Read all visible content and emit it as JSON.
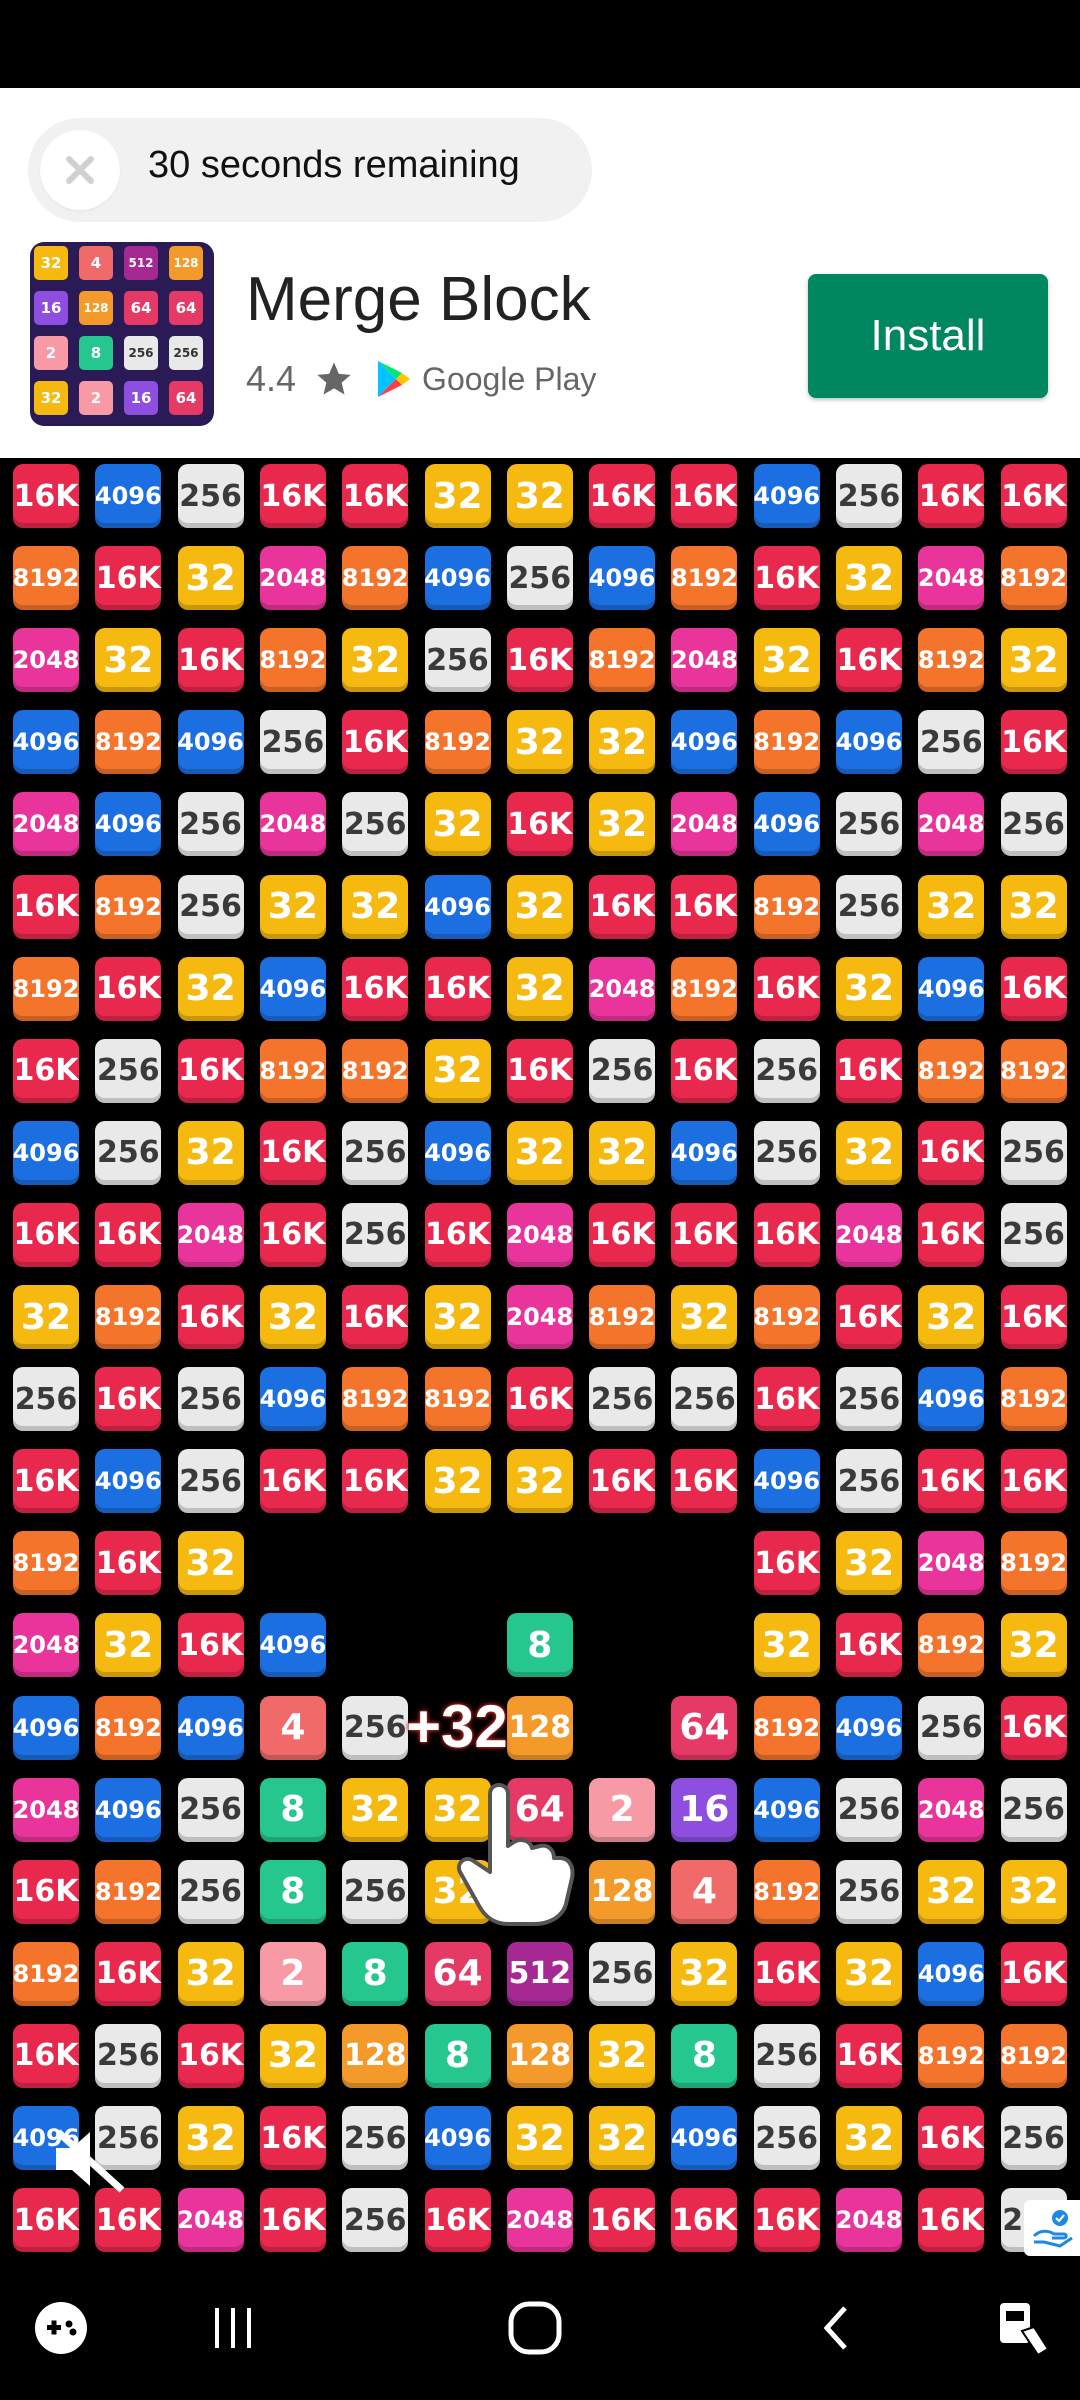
{
  "ad": {
    "countdown_text": "30 seconds remaining",
    "app_name": "Merge Block",
    "rating": "4.4",
    "store_name": "Google Play",
    "install_label": "Install",
    "icon_tiles": [
      "32",
      "4",
      "512",
      "128",
      "16",
      "128",
      "64",
      "64",
      "2",
      "8",
      "256",
      "256",
      "32",
      "2",
      "16",
      "64"
    ]
  },
  "game": {
    "gain_text": "+32",
    "colors": {
      "16K": "#e8294d",
      "8192": "#f4742b",
      "4096": "#1c6fe0",
      "2048": "#e9359b",
      "256": "#e9e9e9",
      "128": "#f49a2a",
      "64": "#e53966",
      "32": "#f5b90f",
      "16": "#8e4fe0",
      "8": "#25c78f",
      "4": "#f06a6a",
      "2": "#f79aa6",
      "512": "#a62893"
    },
    "rows": [
      [
        "16K",
        "4096",
        "256",
        "16K",
        "16K",
        "32",
        "32",
        "16K",
        "16K",
        "4096",
        "256",
        "16K",
        "16K"
      ],
      [
        "8192",
        "16K",
        "32",
        "2048",
        "8192",
        "4096",
        "256",
        "4096",
        "8192",
        "16K",
        "32",
        "2048",
        "8192"
      ],
      [
        "2048",
        "32",
        "16K",
        "8192",
        "32",
        "256",
        "16K",
        "8192",
        "2048",
        "32",
        "16K",
        "8192",
        "32"
      ],
      [
        "4096",
        "8192",
        "4096",
        "256",
        "16K",
        "8192",
        "32",
        "32",
        "4096",
        "8192",
        "4096",
        "256",
        "16K"
      ],
      [
        "2048",
        "4096",
        "256",
        "2048",
        "256",
        "32",
        "16K",
        "32",
        "2048",
        "4096",
        "256",
        "2048",
        "256"
      ],
      [
        "16K",
        "8192",
        "256",
        "32",
        "32",
        "4096",
        "32",
        "16K",
        "16K",
        "8192",
        "256",
        "32",
        "32"
      ],
      [
        "8192",
        "16K",
        "32",
        "4096",
        "16K",
        "16K",
        "32",
        "2048",
        "8192",
        "16K",
        "32",
        "4096",
        "16K"
      ],
      [
        "16K",
        "256",
        "16K",
        "8192",
        "8192",
        "32",
        "16K",
        "256",
        "16K",
        "256",
        "16K",
        "8192",
        "8192"
      ],
      [
        "4096",
        "256",
        "32",
        "16K",
        "256",
        "4096",
        "32",
        "32",
        "4096",
        "256",
        "32",
        "16K",
        "256"
      ],
      [
        "16K",
        "16K",
        "2048",
        "16K",
        "256",
        "16K",
        "2048",
        "16K",
        "16K",
        "16K",
        "2048",
        "16K",
        "256"
      ],
      [
        "32",
        "8192",
        "16K",
        "32",
        "16K",
        "32",
        "2048",
        "8192",
        "32",
        "8192",
        "16K",
        "32",
        "16K"
      ],
      [
        "256",
        "16K",
        "256",
        "4096",
        "8192",
        "8192",
        "16K",
        "256",
        "256",
        "16K",
        "256",
        "4096",
        "8192"
      ],
      [
        "16K",
        "4096",
        "256",
        "16K",
        "16K",
        "32",
        "32",
        "16K",
        "16K",
        "4096",
        "256",
        "16K",
        "16K"
      ],
      [
        "8192",
        "16K",
        "32",
        "",
        "",
        "",
        "",
        "",
        "",
        "16K",
        "32",
        "2048",
        "8192"
      ],
      [
        "2048",
        "32",
        "16K",
        "4096",
        "",
        "",
        "8",
        "",
        "",
        "32",
        "16K",
        "8192",
        "32"
      ],
      [
        "4096",
        "8192",
        "4096",
        "4",
        "256",
        "",
        "128",
        "",
        "64",
        "8192",
        "4096",
        "256",
        "16K"
      ],
      [
        "2048",
        "4096",
        "256",
        "8",
        "32",
        "32",
        "64",
        "2",
        "16",
        "4096",
        "256",
        "2048",
        "256"
      ],
      [
        "16K",
        "8192",
        "256",
        "8",
        "256",
        "32",
        "",
        "128",
        "4",
        "8192",
        "256",
        "32",
        "32"
      ],
      [
        "8192",
        "16K",
        "32",
        "2",
        "8",
        "64",
        "512",
        "256",
        "32",
        "16K",
        "32",
        "4096",
        "16K"
      ],
      [
        "16K",
        "256",
        "16K",
        "32",
        "128",
        "8",
        "128",
        "32",
        "8",
        "256",
        "16K",
        "8192",
        "8192"
      ],
      [
        "4096",
        "256",
        "32",
        "16K",
        "256",
        "4096",
        "32",
        "32",
        "4096",
        "256",
        "32",
        "16K",
        "256"
      ],
      [
        "16K",
        "16K",
        "2048",
        "16K",
        "256",
        "16K",
        "2048",
        "16K",
        "16K",
        "16K",
        "2048",
        "16K",
        "256"
      ]
    ]
  },
  "nav": {
    "game_launcher": "gamepad-icon",
    "recents": "recents-icon",
    "home": "home-icon",
    "back": "back-icon",
    "screenshot": "screenshot-icon"
  }
}
